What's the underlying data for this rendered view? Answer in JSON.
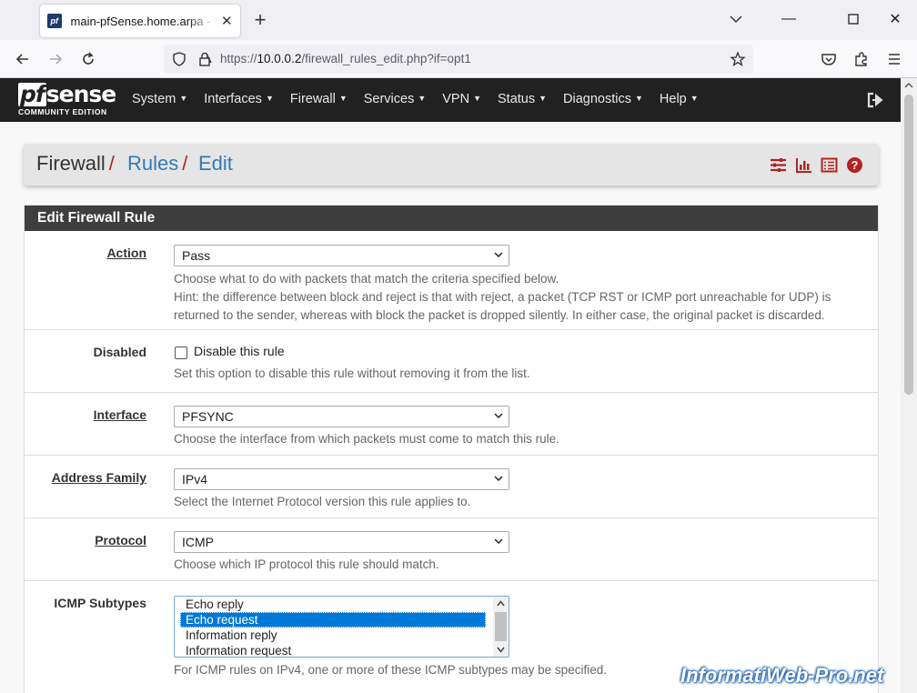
{
  "browser": {
    "tab_title": "main-pfSense.home.arpa - Firefox",
    "favicon_text": "pf",
    "url_prefix": "https://",
    "url_host": "10.0.0.2",
    "url_path": "/firewall_rules_edit.php?if=opt1"
  },
  "brand": {
    "logo_text": "sense",
    "logo_pf": "pf",
    "edition": "COMMUNITY EDITION"
  },
  "menu": [
    "System",
    "Interfaces",
    "Firewall",
    "Services",
    "VPN",
    "Status",
    "Diagnostics",
    "Help"
  ],
  "breadcrumb": {
    "root": "Firewall",
    "rules": "Rules",
    "edit": "Edit",
    "separator": "/"
  },
  "panel_title": "Edit Firewall Rule",
  "form": {
    "action": {
      "label": "Action",
      "value": "Pass",
      "help1": "Choose what to do with packets that match the criteria specified below.",
      "help2": "Hint: the difference between block and reject is that with reject, a packet (TCP RST or ICMP port unreachable for UDP) is",
      "help3": "returned to the sender, whereas with block the packet is dropped silently. In either case, the original packet is discarded."
    },
    "disabled": {
      "label": "Disabled",
      "checkbox_label": "Disable this rule",
      "help": "Set this option to disable this rule without removing it from the list."
    },
    "interface": {
      "label": "Interface",
      "value": "PFSYNC",
      "help": "Choose the interface from which packets must come to match this rule."
    },
    "address_family": {
      "label": "Address Family",
      "value": "IPv4",
      "help": "Select the Internet Protocol version this rule applies to."
    },
    "protocol": {
      "label": "Protocol",
      "value": "ICMP",
      "help": "Choose which IP protocol this rule should match."
    },
    "icmp_subtypes": {
      "label": "ICMP Subtypes",
      "options": [
        "Echo reply",
        "Echo request",
        "Information reply",
        "Information request"
      ],
      "selected": "Echo request",
      "help": "For ICMP rules on IPv4, one or more of these ICMP subtypes may be specified."
    }
  },
  "watermark": "InformatiWeb-Pro.net",
  "colors": {
    "header_bg": "#212121",
    "link": "#337ab7",
    "accent_red": "#b22222",
    "selection": "#0078d7"
  }
}
